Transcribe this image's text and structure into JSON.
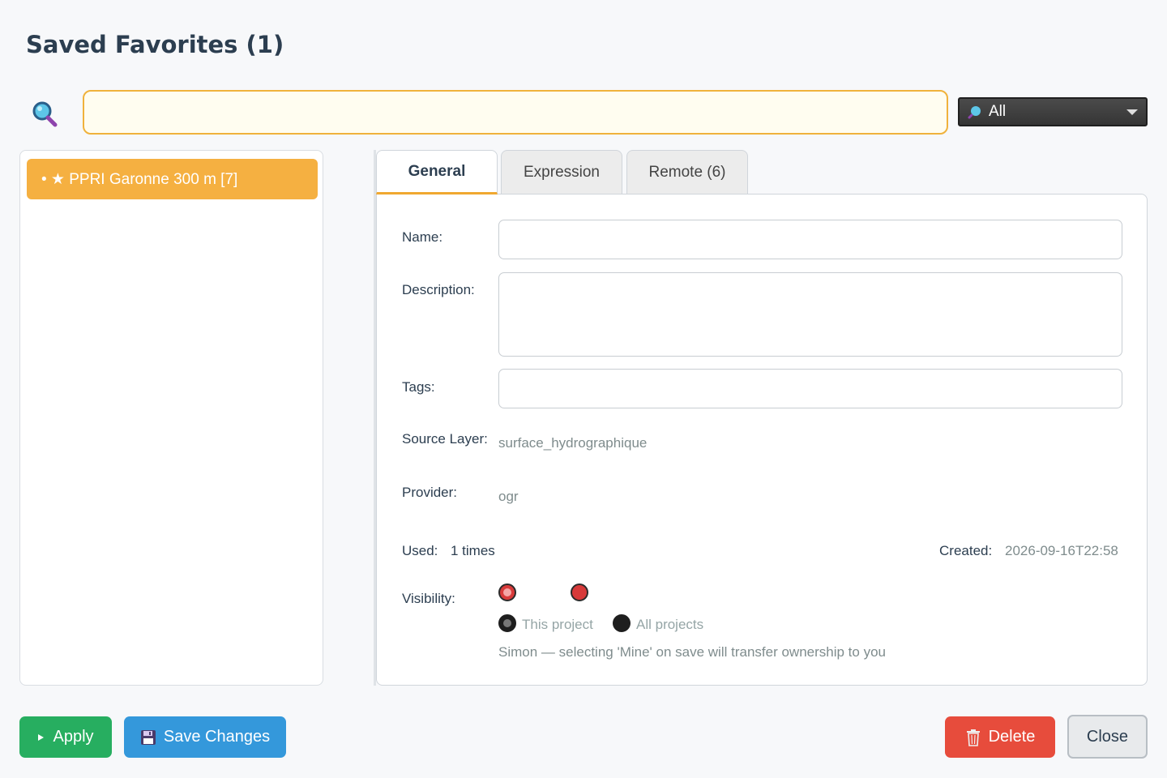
{
  "header": {
    "title": "Saved Favorites (1)"
  },
  "search": {
    "value": "",
    "placeholder": ""
  },
  "filter": {
    "selected": "All"
  },
  "favorites": [
    {
      "label": "• ★ PPRI Garonne 300 m [7]"
    }
  ],
  "tabs": [
    {
      "label": "General"
    },
    {
      "label": "Expression"
    },
    {
      "label": "Remote (6)"
    }
  ],
  "general": {
    "name_label": "Name:",
    "name_value": "",
    "description_label": "Description:",
    "description_value": "",
    "tags_label": "Tags:",
    "tags_value": "",
    "source_layer_label": "Source Layer:",
    "source_layer_value": "surface_hydrographique",
    "provider_label": "Provider:",
    "provider_value": "ogr",
    "used_label": "Used:",
    "used_value": "1 times",
    "created_label": "Created:",
    "created_value": "2026-09-16T22:58",
    "visibility_label": "Visibility:",
    "visibility_scope_this": "This project",
    "visibility_scope_all": "All projects",
    "ownership_note": "Simon — selecting 'Mine' on save will transfer ownership to you"
  },
  "actions": {
    "apply": "Apply",
    "save": "Save Changes",
    "delete": "Delete",
    "close": "Close"
  },
  "colors": {
    "accent": "#f5b041",
    "apply": "#27ae60",
    "save": "#3498db",
    "delete": "#e74c3c"
  }
}
